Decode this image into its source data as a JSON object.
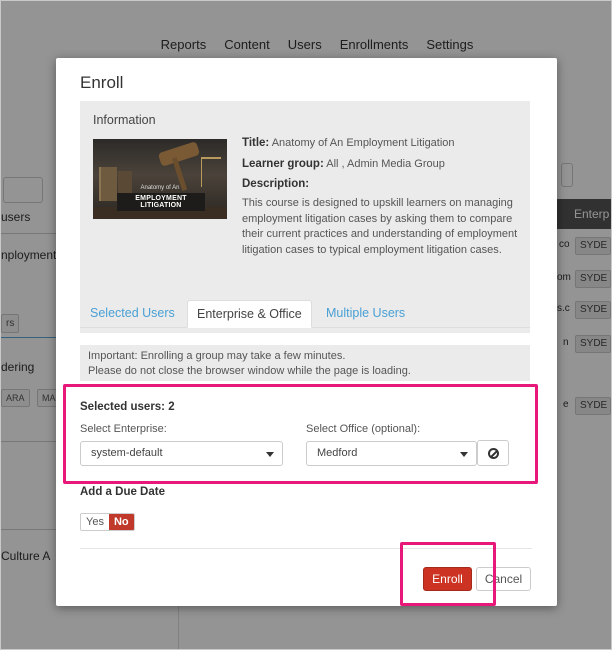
{
  "background": {
    "nav": [
      "Reports",
      "Content",
      "Users",
      "Enrollments",
      "Settings"
    ],
    "left_fragments": {
      "users_tab": "users",
      "employment": "nployment",
      "small_btn": "rs",
      "ordering": "dering",
      "chip1": "ARA",
      "chip2": "MA",
      "culture": "Culture A"
    },
    "right_header": "Enterp",
    "right_rows": [
      {
        "frag": "co",
        "chip": "SYDE"
      },
      {
        "frag": "om",
        "chip": "SYDE"
      },
      {
        "frag": "s.c",
        "chip": "SYDE"
      },
      {
        "frag": "n",
        "chip": "SYDE"
      },
      {
        "frag": "e",
        "chip": "SYDE"
      }
    ]
  },
  "modal": {
    "title": "Enroll",
    "information": {
      "heading": "Information",
      "thumbnail": {
        "caption_small": "Anatomy of An",
        "caption_large": "EMPLOYMENT LITIGATION"
      },
      "title_label": "Title:",
      "title_value": "Anatomy of An Employment Litigation",
      "learner_group_label": "Learner group:",
      "learner_group_value": "All , Admin Media Group",
      "description_label": "Description:",
      "description_text": "This course is designed to upskill learners on managing employment litigation cases by asking them to compare their current practices and understanding of employment litigation cases to typical employment litigation cases."
    },
    "tabs": [
      {
        "label": "Selected Users",
        "active": false
      },
      {
        "label": "Enterprise & Office",
        "active": true
      },
      {
        "label": "Multiple Users",
        "active": false
      }
    ],
    "notice": {
      "line1": "Important: Enrolling a group may take a few minutes.",
      "line2": "Please do not close the browser window while the page is loading."
    },
    "selected_users": "Selected users: 2",
    "enterprise": {
      "label": "Select Enterprise:",
      "value": "system-default"
    },
    "office": {
      "label": "Select Office (optional):",
      "value": "Medford"
    },
    "due_date": {
      "label": "Add a Due Date",
      "yes": "Yes",
      "no": "No",
      "selected": "No"
    },
    "buttons": {
      "enroll": "Enroll",
      "cancel": "Cancel"
    }
  },
  "colors": {
    "accent_link": "#4aa0d5",
    "primary_button": "#cc3322",
    "annotation": "#e8177a"
  }
}
